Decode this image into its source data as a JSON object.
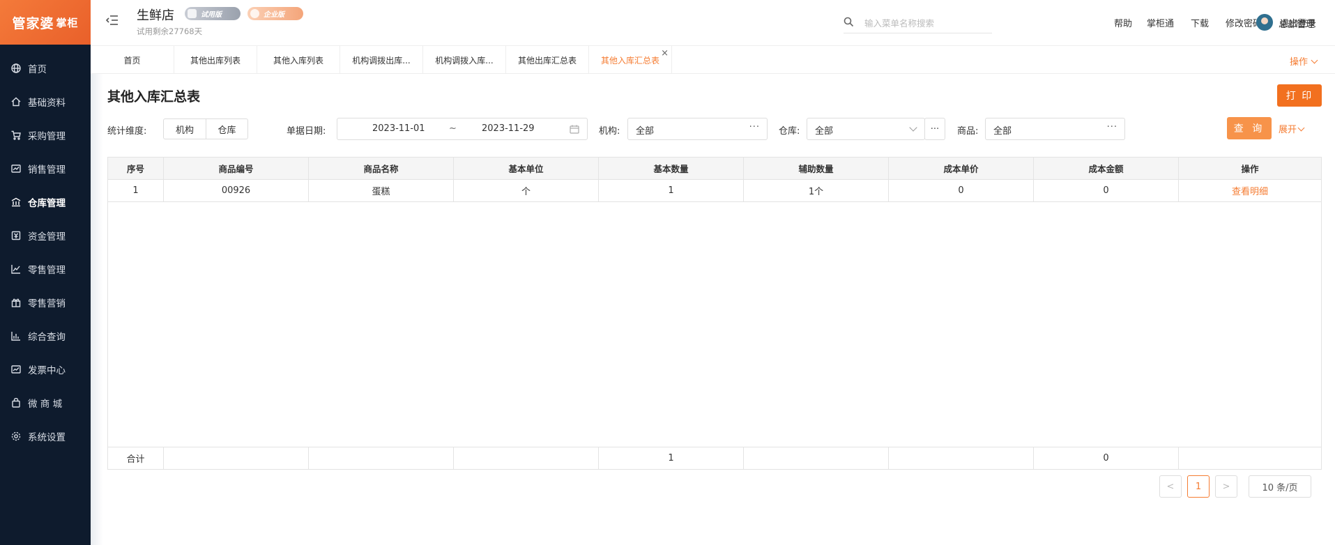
{
  "brand": {
    "logo_text": "管家婆",
    "logo_sub": "掌柜"
  },
  "sidebar": {
    "items": [
      {
        "label": "首页",
        "icon": "globe-icon"
      },
      {
        "label": "基础资料",
        "icon": "home-icon"
      },
      {
        "label": "采购管理",
        "icon": "cart-icon"
      },
      {
        "label": "销售管理",
        "icon": "sales-icon"
      },
      {
        "label": "仓库管理",
        "icon": "warehouse-icon"
      },
      {
        "label": "资金管理",
        "icon": "fund-icon"
      },
      {
        "label": "零售管理",
        "icon": "retail-chart-icon"
      },
      {
        "label": "零售营销",
        "icon": "gift-icon"
      },
      {
        "label": "综合查询",
        "icon": "bar-chart-icon"
      },
      {
        "label": "发票中心",
        "icon": "invoice-icon"
      },
      {
        "label": "微 商 城",
        "icon": "bag-icon"
      },
      {
        "label": "系统设置",
        "icon": "settings-icon"
      }
    ],
    "active_index": 4
  },
  "header": {
    "store_name": "生鲜店",
    "trial_info": "试用剩余27768天",
    "badge_trial": "试用版",
    "badge_enterprise": "企业版",
    "search_placeholder": "输入菜单名称搜索",
    "links": [
      "帮助",
      "掌柜通",
      "下载",
      "修改密码",
      "退出登录"
    ],
    "username": "总部管理"
  },
  "tabs": {
    "items": [
      "首页",
      "其他出库列表",
      "其他入库列表",
      "机构调拨出库...",
      "机构调拨入库...",
      "其他出库汇总表",
      "其他入库汇总表"
    ],
    "active_index": 6,
    "operations": "操作"
  },
  "page": {
    "title": "其他入库汇总表",
    "print_label": "打 印",
    "filters": {
      "dimension_label": "统计维度:",
      "dimension_options": [
        "机构",
        "仓库"
      ],
      "date_label": "单据日期:",
      "date_start": "2023-11-01",
      "date_sep": "~",
      "date_end": "2023-11-29",
      "org_label": "机构:",
      "org_value": "全部",
      "warehouse_label": "仓库:",
      "warehouse_value": "全部",
      "product_label": "商品:",
      "product_value": "全部",
      "query_label": "查 询",
      "expand_label": "展开"
    },
    "table": {
      "columns": [
        "序号",
        "商品编号",
        "商品名称",
        "基本单位",
        "基本数量",
        "辅助数量",
        "成本单价",
        "成本金额",
        "操作"
      ],
      "rows": [
        [
          "1",
          "00926",
          "蛋糕",
          "个",
          "1",
          "1个",
          "0",
          "0",
          "查看明细"
        ]
      ],
      "footer": [
        "合计",
        "",
        "",
        "",
        "1",
        "",
        "",
        "0",
        ""
      ]
    },
    "pagination": {
      "prev": "<",
      "current": "1",
      "next": ">",
      "page_size": "10 条/页"
    }
  },
  "colors": {
    "accent": "#f57c32",
    "sidebar_bg": "#0e1b2d",
    "print_button": "#f2701f"
  }
}
